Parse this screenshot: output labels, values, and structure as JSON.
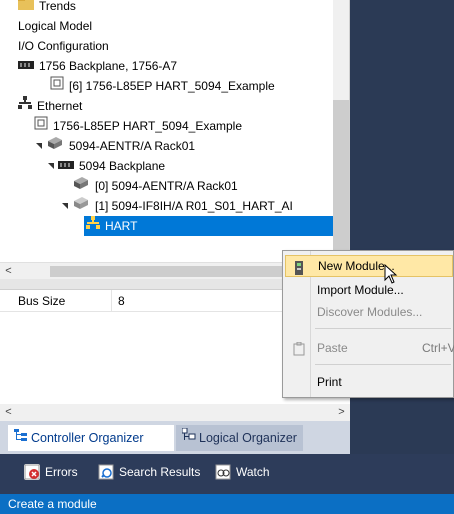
{
  "tree": {
    "items": [
      {
        "label": "Trends",
        "icon": "folder-icon"
      },
      {
        "label": "Logical Model",
        "icon": ""
      },
      {
        "label": "I/O Configuration",
        "icon": ""
      },
      {
        "label": "1756 Backplane, 1756-A7",
        "icon": "backplane-icon"
      },
      {
        "label": "[6] 1756-L85EP HART_5094_Example",
        "icon": "controller-icon"
      },
      {
        "label": "Ethernet",
        "icon": "network-icon"
      },
      {
        "label": "1756-L85EP HART_5094_Example",
        "icon": "controller-icon"
      },
      {
        "label": "5094-AENTR/A Rack01",
        "icon": "adapter-icon"
      },
      {
        "label": "5094 Backplane",
        "icon": "backplane-icon"
      },
      {
        "label": "[0] 5094-AENTR/A Rack01",
        "icon": "adapter-icon"
      },
      {
        "label": "[1] 5094-IF8IH/A R01_S01_HART_AI",
        "icon": "module-icon"
      },
      {
        "label": "HART",
        "icon": "network-icon"
      }
    ]
  },
  "properties": {
    "rows": [
      {
        "name": "Bus Size",
        "value": "8"
      }
    ]
  },
  "scroll": {
    "left_arrow": "<",
    "right_arrow": ">"
  },
  "organizer_tabs": [
    {
      "label": "Controller Organizer",
      "active": true
    },
    {
      "label": "Logical Organizer",
      "active": false
    }
  ],
  "bottom_tabs": [
    {
      "label": "Errors"
    },
    {
      "label": "Search Results"
    },
    {
      "label": "Watch"
    }
  ],
  "context_menu": {
    "items": [
      {
        "label": "New Module...",
        "shortcut": "",
        "enabled": true,
        "highlighted": true
      },
      {
        "label": "Import Module...",
        "shortcut": "",
        "enabled": true,
        "highlighted": false
      },
      {
        "label": "Discover Modules...",
        "shortcut": "",
        "enabled": false,
        "highlighted": false
      },
      {
        "label": "Paste",
        "shortcut": "Ctrl+V",
        "enabled": false,
        "highlighted": false
      },
      {
        "label": "Print",
        "shortcut": "",
        "enabled": true,
        "highlighted": false
      }
    ]
  },
  "status_bar": {
    "text": "Create a module"
  },
  "colors": {
    "selection": "#0078d7",
    "status_bar": "#0b6fc4",
    "menu_highlight": "#ffe8a6",
    "dark_background": "#2b3a55"
  }
}
